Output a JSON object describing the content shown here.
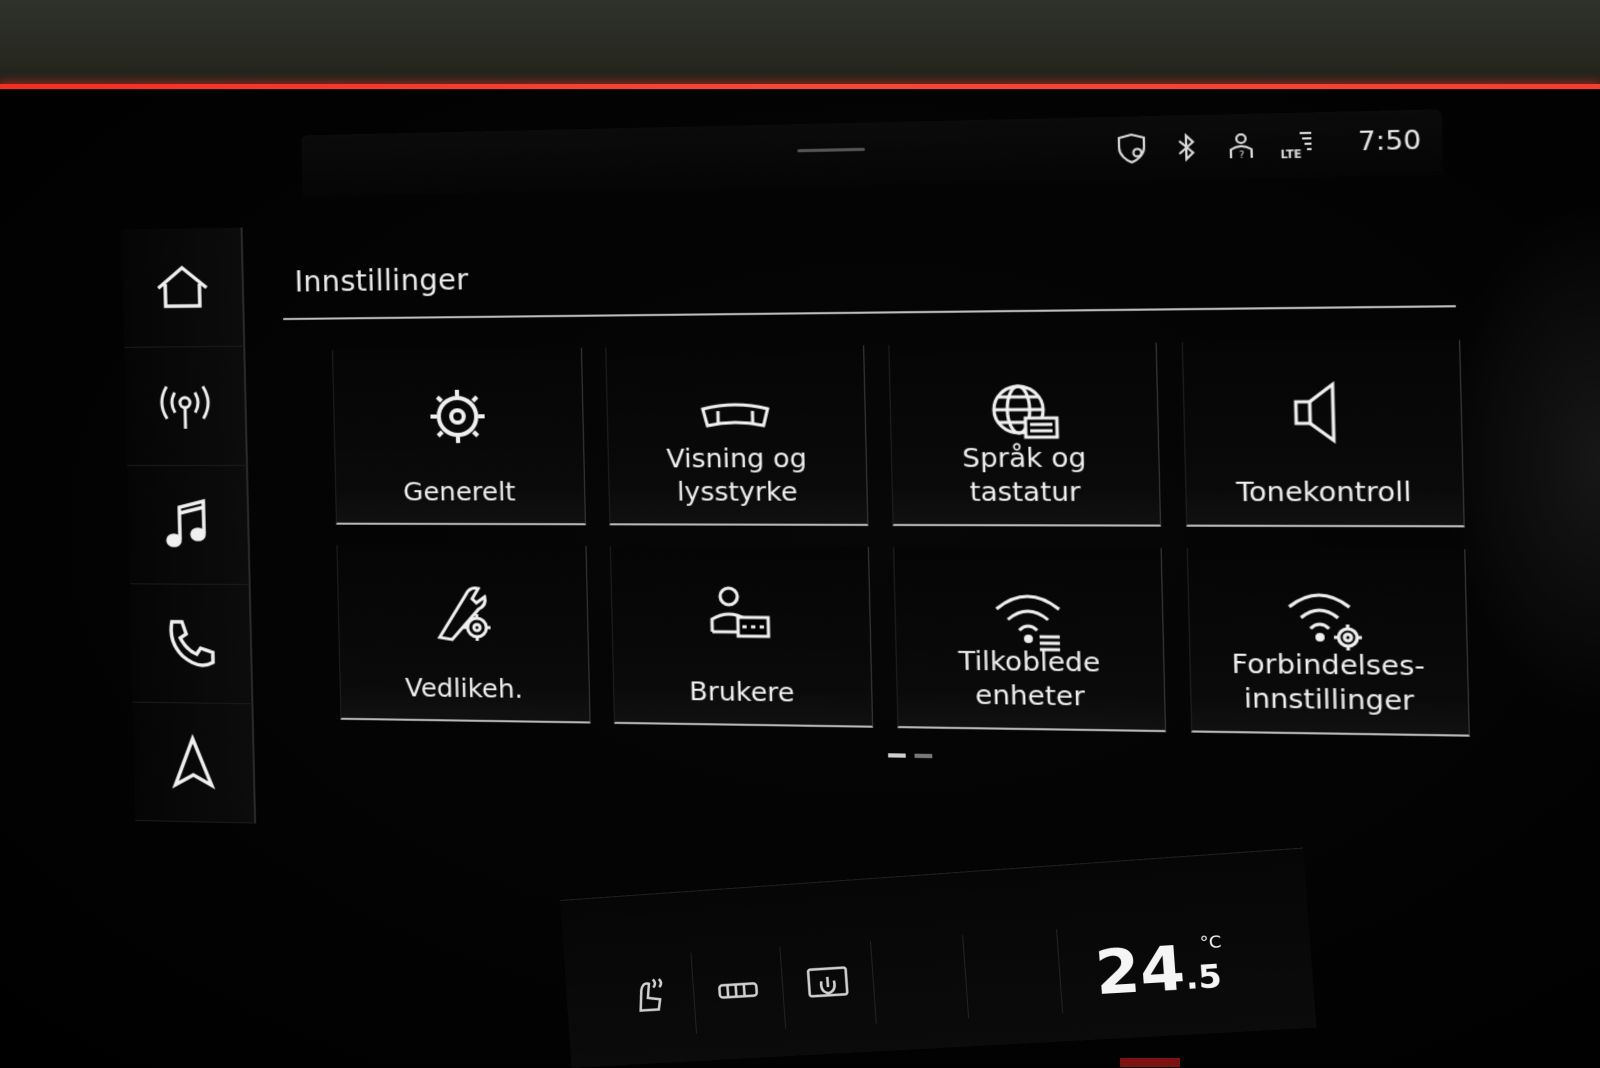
{
  "status_bar": {
    "time": "7:50",
    "icons": [
      "location-privacy-icon",
      "bluetooth-icon",
      "user-unknown-icon",
      "lte-signal-icon"
    ]
  },
  "sidebar": {
    "items": [
      {
        "name": "home",
        "icon": "home-icon"
      },
      {
        "name": "radio",
        "icon": "radio-antenna-icon"
      },
      {
        "name": "media",
        "icon": "music-note-icon"
      },
      {
        "name": "phone",
        "icon": "phone-icon"
      },
      {
        "name": "navigation",
        "icon": "navigation-arrow-icon"
      }
    ]
  },
  "header": {
    "title": "Innstillinger"
  },
  "tiles": [
    {
      "label": "Generelt",
      "icon": "gear-icon"
    },
    {
      "label": "Visning og\nlysstyrke",
      "icon": "display-icon"
    },
    {
      "label": "Språk og\ntastatur",
      "icon": "globe-keyboard-icon"
    },
    {
      "label": "Tonekontroll",
      "icon": "speaker-icon"
    },
    {
      "label": "Vedlikeh.",
      "icon": "wrench-gear-icon"
    },
    {
      "label": "Brukere",
      "icon": "user-card-icon"
    },
    {
      "label": "Tilkoblede\nenheter",
      "icon": "wifi-devices-icon"
    },
    {
      "label": "Forbindelses-\ninnstillinger",
      "icon": "wifi-gear-icon"
    }
  ],
  "pagination": {
    "current": 1,
    "total": 2
  },
  "climate": {
    "temperature_main": "24",
    "temperature_decimal": ".5",
    "temperature_unit": "°C",
    "icons": [
      "seat-heat-icon",
      "rear-defrost-icon",
      "climate-power-icon"
    ]
  },
  "colors": {
    "ambient_light": "#ff3a2c",
    "text": "#e8e8e8",
    "tile_border": "#b8b8b8"
  }
}
